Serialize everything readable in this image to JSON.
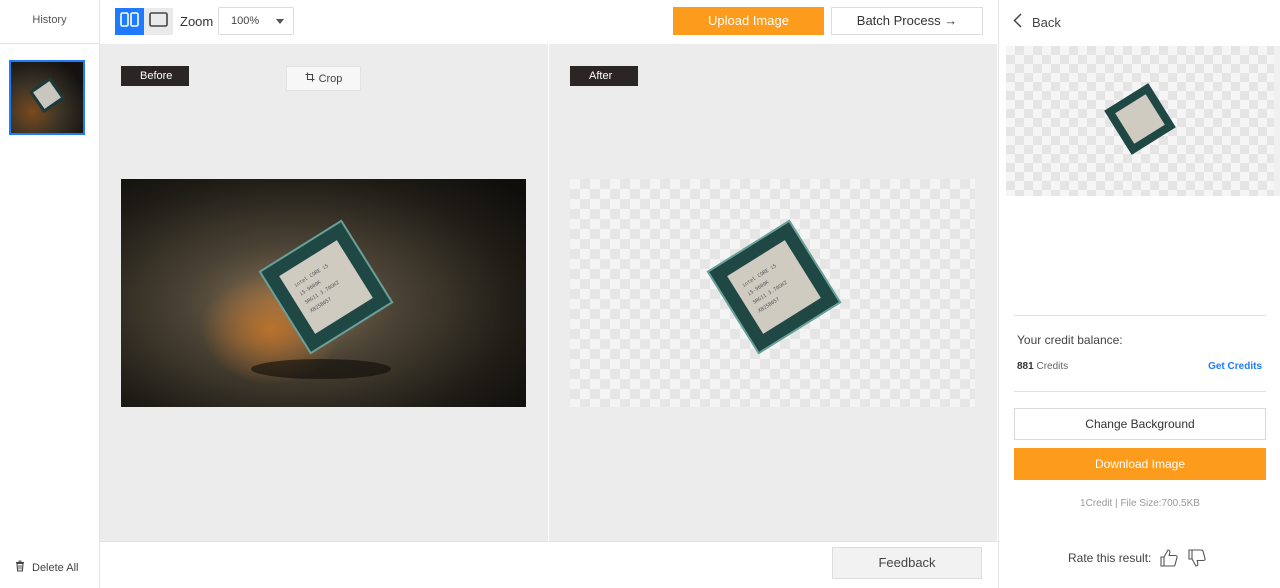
{
  "history": {
    "title": "History",
    "delete_all_label": "Delete All"
  },
  "toolbar": {
    "zoom_label": "Zoom",
    "zoom_value": "100%",
    "upload_label": "Upload Image",
    "batch_label": "Batch Process →"
  },
  "panes": {
    "before_label": "Before",
    "crop_label": "Crop",
    "after_label": "After"
  },
  "bottom": {
    "feedback_label": "Feedback"
  },
  "right_panel": {
    "back_label": "Back",
    "credit_title": "Your credit balance:",
    "credit_amount": "881",
    "credit_unit": "Credits",
    "get_credits_label": "Get Credits",
    "change_background_label": "Change Background",
    "download_label": "Download Image",
    "file_info": "1Credit | File Size:700.5KB",
    "rate_label": "Rate this result:"
  },
  "colors": {
    "accent_blue": "#1e7bff",
    "accent_orange": "#fd9b1c",
    "label_dark": "#2b2523"
  },
  "icons": [
    "split-view-icon",
    "single-view-icon",
    "caret-down-icon",
    "crop-icon",
    "trash-icon",
    "chevron-left-icon",
    "thumbs-up-icon",
    "thumbs-down-icon"
  ]
}
